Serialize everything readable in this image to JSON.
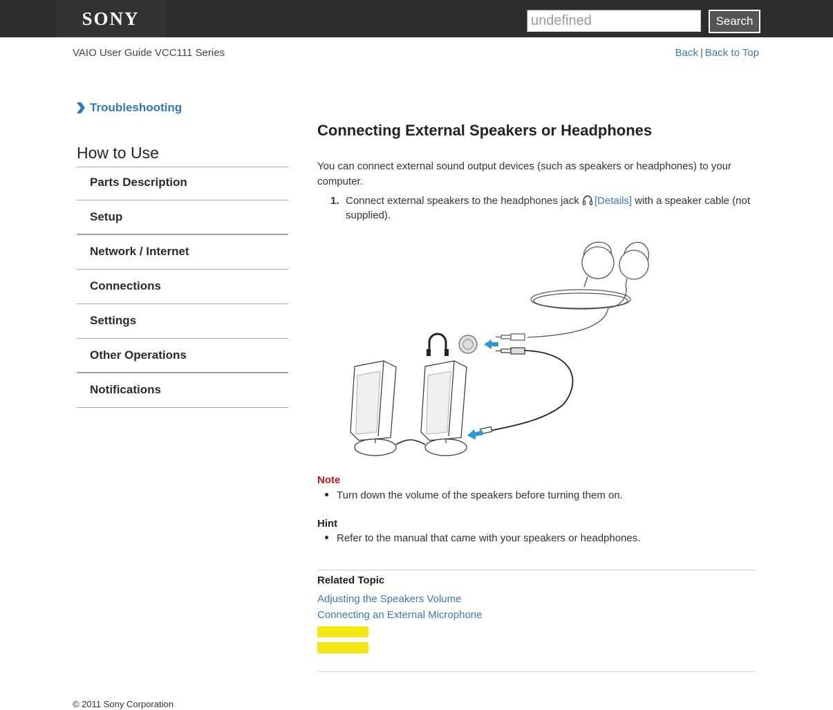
{
  "header": {
    "brand": "SONY",
    "search": {
      "value": "",
      "placeholder": "undefined",
      "button_label": "Search"
    }
  },
  "subheader": {
    "guide_title": "VAIO User Guide VCC111 Series",
    "links": {
      "back": "Back",
      "separator": "|",
      "back_to_top": "Back to Top"
    }
  },
  "sidebar": {
    "troubleshooting": {
      "icon": "chevron-right-icon",
      "label": "Troubleshooting"
    },
    "section_title": "How to Use",
    "items": [
      {
        "label": "Parts Description"
      },
      {
        "label": "Setup"
      },
      {
        "label": "Network / Internet"
      },
      {
        "label": "Connections"
      },
      {
        "label": "Settings"
      },
      {
        "label": "Other Operations"
      },
      {
        "label": "Notifications"
      }
    ]
  },
  "main": {
    "title": "Connecting External Speakers or Headphones",
    "intro": "You can connect external sound output devices (such as speakers or headphones) to your computer.",
    "steps": [
      {
        "number": "1.",
        "text_before": "Connect external speakers to the headphones jack ",
        "icon": "headphones-icon",
        "link": "[Details]",
        "text_after": " with a speaker cable (not supplied)."
      }
    ],
    "figure": {
      "description": "Illustration: headphones and speaker plugs connecting to a headphones jack",
      "arrow_color": "#2b9bd8"
    },
    "note": {
      "heading": "Note",
      "items": [
        "Turn down the volume of the speakers before turning them on."
      ],
      "color": "#c8171e"
    },
    "hint": {
      "heading": "Hint",
      "items": [
        "Refer to the manual that came with your speakers or headphones."
      ]
    },
    "related": {
      "heading": "Related Topic",
      "links": [
        "Adjusting the Speakers Volume",
        "Connecting an External Microphone"
      ],
      "highlight_color": "#f5e914"
    }
  },
  "footer": {
    "copyright": "© 2011 Sony Corporation"
  },
  "colors": {
    "link": "#3a7ac0",
    "header_bg": "#2e2c2d"
  }
}
